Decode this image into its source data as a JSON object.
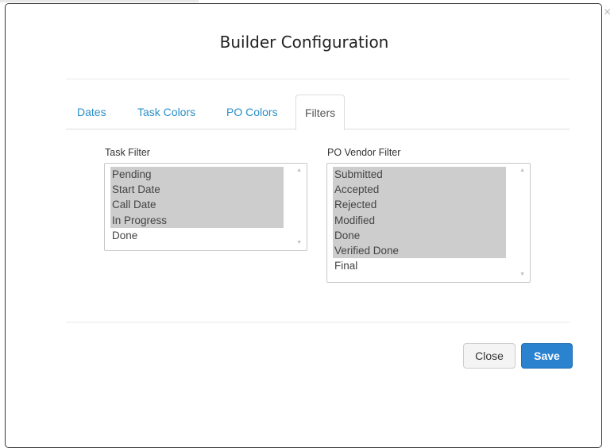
{
  "modal": {
    "title": "Builder Configuration",
    "close_glyph": "×"
  },
  "tabs": [
    {
      "label": "Dates",
      "active": false
    },
    {
      "label": "Task Colors",
      "active": false
    },
    {
      "label": "PO Colors",
      "active": false
    },
    {
      "label": "Filters",
      "active": true
    }
  ],
  "task_filter": {
    "label": "Task Filter",
    "options": [
      {
        "label": "Pending",
        "selected": true
      },
      {
        "label": "Start Date",
        "selected": true
      },
      {
        "label": "Call Date",
        "selected": true
      },
      {
        "label": "In Progress",
        "selected": true
      },
      {
        "label": "Done",
        "selected": false
      }
    ]
  },
  "po_vendor_filter": {
    "label": "PO Vendor Filter",
    "options": [
      {
        "label": "Submitted",
        "selected": true
      },
      {
        "label": "Accepted",
        "selected": true
      },
      {
        "label": "Rejected",
        "selected": true
      },
      {
        "label": "Modified",
        "selected": true
      },
      {
        "label": "Done",
        "selected": true
      },
      {
        "label": "Verified Done",
        "selected": true
      },
      {
        "label": "Final",
        "selected": false
      }
    ]
  },
  "footer": {
    "close_label": "Close",
    "save_label": "Save"
  },
  "colors": {
    "tab_link": "#2a8fc9",
    "primary_button": "#2b82cf",
    "selected_option": "#cdcdcd"
  }
}
